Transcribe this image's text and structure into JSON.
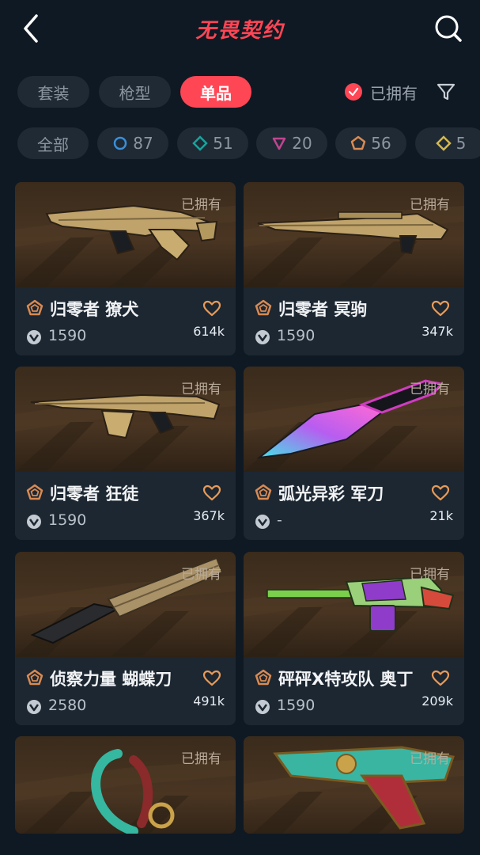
{
  "header": {
    "title": "无畏契约"
  },
  "tabs": [
    {
      "label": "套装",
      "active": false
    },
    {
      "label": "枪型",
      "active": false
    },
    {
      "label": "单品",
      "active": true
    }
  ],
  "owned_filter": {
    "label": "已拥有",
    "checked": true
  },
  "rarity_filters": [
    {
      "label": "全部",
      "icon": "",
      "color": ""
    },
    {
      "label": "87",
      "icon": "circle-tier-icon",
      "color": "#3a8fd9"
    },
    {
      "label": "51",
      "icon": "diamond-tier-icon",
      "color": "#19a39a"
    },
    {
      "label": "20",
      "icon": "triangle-tier-icon",
      "color": "#c0458f"
    },
    {
      "label": "56",
      "icon": "pentagon-tier-icon",
      "color": "#d98a52"
    },
    {
      "label": "5",
      "icon": "diamond-gold-tier-icon",
      "color": "#d6b84a"
    }
  ],
  "items": [
    {
      "name": "归零者 獠犬",
      "price": "1590",
      "likes": "614k",
      "owned": "已拥有",
      "weapon": "rifle-gold"
    },
    {
      "name": "归零者 冥驹",
      "price": "1590",
      "likes": "347k",
      "owned": "已拥有",
      "weapon": "sniper-gold"
    },
    {
      "name": "归零者 狂徒",
      "price": "1590",
      "likes": "367k",
      "owned": "已拥有",
      "weapon": "ak-gold"
    },
    {
      "name": "弧光异彩 军刀",
      "price": "-",
      "likes": "21k",
      "owned": "已拥有",
      "weapon": "knife-neon"
    },
    {
      "name": "侦察力量 蝴蝶刀",
      "price": "2580",
      "likes": "491k",
      "owned": "已拥有",
      "weapon": "butterfly-knife"
    },
    {
      "name": "砰砰X特攻队 奥丁",
      "price": "1590",
      "likes": "209k",
      "owned": "已拥有",
      "weapon": "odin-green"
    },
    {
      "name": "",
      "price": "",
      "likes": "",
      "owned": "已拥有",
      "weapon": "karambit-jade"
    },
    {
      "name": "",
      "price": "",
      "likes": "",
      "owned": "已拥有",
      "weapon": "revolver-jade"
    }
  ],
  "colors": {
    "accent": "#ff4655",
    "background": "#0f1923",
    "card": "#1c2732",
    "tier_pentagon": "#d98a52"
  }
}
